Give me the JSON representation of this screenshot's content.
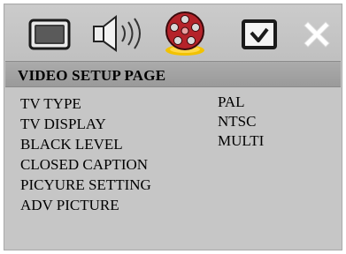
{
  "page_title": "VIDEO SETUP PAGE",
  "icons": [
    {
      "name": "general-setup",
      "icon": "tv-screen-icon"
    },
    {
      "name": "audio-setup",
      "icon": "speaker-icon"
    },
    {
      "name": "video-setup",
      "icon": "film-reel-icon",
      "selected": true
    },
    {
      "name": "preference",
      "icon": "checkbox-icon"
    },
    {
      "name": "exit",
      "icon": "close-icon"
    }
  ],
  "menu_items": [
    {
      "label": "TV TYPE"
    },
    {
      "label": "TV DISPLAY"
    },
    {
      "label": "BLACK LEVEL"
    },
    {
      "label": "CLOSED CAPTION"
    },
    {
      "label": "PICYURE SETTING"
    },
    {
      "label": "ADV PICTURE"
    }
  ],
  "options": [
    {
      "label": "PAL"
    },
    {
      "label": "NTSC"
    },
    {
      "label": "MULTI"
    }
  ],
  "colors": {
    "background": "#c6c6c6",
    "title_bar": "#a0a0a0",
    "selected_icon": "#b5232a",
    "selected_glow": "#f2c200"
  }
}
